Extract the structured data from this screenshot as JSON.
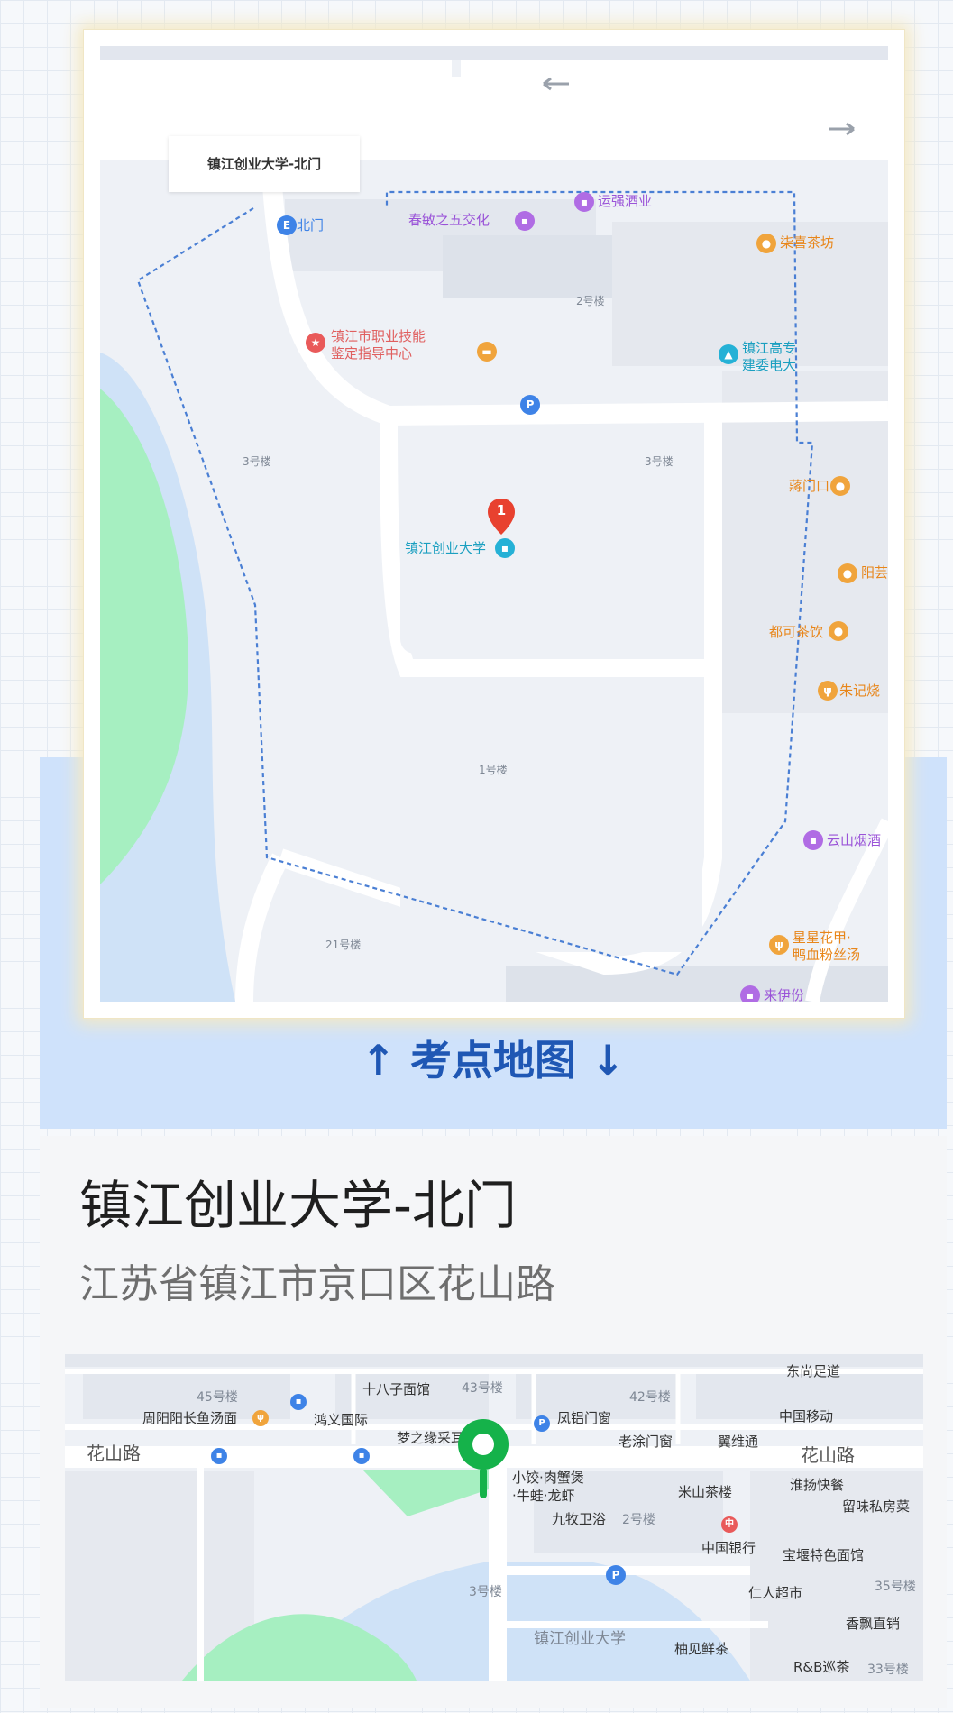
{
  "map_section": {
    "gate_label": "镇江创业大学-北门",
    "caption": "↑ 考点地图 ↓",
    "pois": {
      "north_gate": "北门",
      "yunqiang": "运强酒业",
      "chunmin": "春敏之五交化",
      "chaxi": "柒喜茶坊",
      "building_2": "2号楼",
      "vocational_line1": "镇江市职业技能",
      "vocational_line2": "鉴定指导中心",
      "gaozhuan_line1": "镇江高专",
      "gaozhuan_line2": "建委电大",
      "building_3_left": "3号楼",
      "building_3_right": "3号楼",
      "jiangmenkou": "蔣门口",
      "university": "镇江创业大学",
      "yangjia": "阳芸",
      "duke": "都可茶饮",
      "zhuji": "朱记烧",
      "building_1": "1号楼",
      "yunshan": "云山烟酒",
      "building_21": "21号楼",
      "xingxing_line1": "星星花甲·",
      "xingxing_line2": "鸭血粉丝汤",
      "laiyifen": "来伊份",
      "marker_number": "1"
    },
    "icons": [
      "direction-arrow-left-icon",
      "direction-arrow-right-icon",
      "parking-icon",
      "location-pin-icon",
      "shop-icon",
      "restaurant-icon",
      "school-icon",
      "landmark-icon"
    ],
    "colors": {
      "boundary": "#4a7fd4",
      "water": "#cfe2f7",
      "green": "#a6efc1",
      "marker": "#e8412f"
    }
  },
  "place": {
    "name": "镇江创业大学-北门",
    "address": "江苏省镇江市京口区花山路"
  },
  "mini_map": {
    "roads": {
      "huashan_left": "花山路",
      "huashan_right": "花山路"
    },
    "labels": {
      "dongshang": "东尚足道",
      "shibazi": "十八子面馆",
      "b43": "43号楼",
      "b45": "45号楼",
      "b42": "42号楼",
      "zhouyang": "周阳阳长鱼汤面",
      "hongyi": "鸿义国际",
      "fenglv": "凤铝门窗",
      "mobile": "中国移动",
      "mengzhiyuan": "梦之缘采耳",
      "laotu": "老涂门窗",
      "yiweitong": "翼维通",
      "xiaojiao_line1": "小饺·肉蟹煲",
      "xiaojiao_line2": "·牛蛙·龙虾",
      "huaiyang": "淮扬快餐",
      "mishan": "米山茶楼",
      "liuwei": "留味私房菜",
      "jiumu": "九牧卫浴",
      "b2": "2号楼",
      "bank": "中国银行",
      "baodui": "宝堰特色面馆",
      "b3": "3号楼",
      "renren": "仁人超市",
      "b35": "35号楼",
      "xiangpiao": "香飘直销",
      "univ": "镇江创业大学",
      "youjian": "柚见鲜茶",
      "rb": "R&B巡茶",
      "b33": "33号楼"
    },
    "colors": {
      "pin": "#15b24a",
      "green": "#a6efc1"
    }
  }
}
